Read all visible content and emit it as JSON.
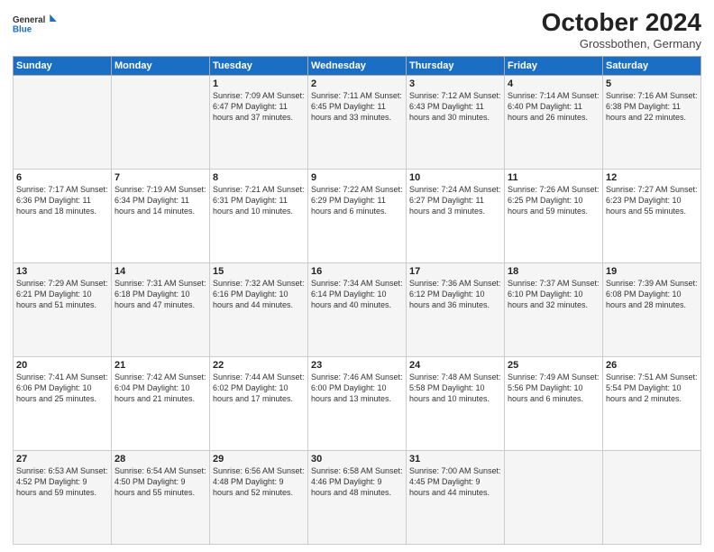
{
  "logo": {
    "general": "General",
    "blue": "Blue"
  },
  "header": {
    "month": "October 2024",
    "location": "Grossbothen, Germany"
  },
  "weekdays": [
    "Sunday",
    "Monday",
    "Tuesday",
    "Wednesday",
    "Thursday",
    "Friday",
    "Saturday"
  ],
  "weeks": [
    [
      {
        "day": "",
        "detail": ""
      },
      {
        "day": "",
        "detail": ""
      },
      {
        "day": "1",
        "detail": "Sunrise: 7:09 AM\nSunset: 6:47 PM\nDaylight: 11 hours and 37 minutes."
      },
      {
        "day": "2",
        "detail": "Sunrise: 7:11 AM\nSunset: 6:45 PM\nDaylight: 11 hours and 33 minutes."
      },
      {
        "day": "3",
        "detail": "Sunrise: 7:12 AM\nSunset: 6:43 PM\nDaylight: 11 hours and 30 minutes."
      },
      {
        "day": "4",
        "detail": "Sunrise: 7:14 AM\nSunset: 6:40 PM\nDaylight: 11 hours and 26 minutes."
      },
      {
        "day": "5",
        "detail": "Sunrise: 7:16 AM\nSunset: 6:38 PM\nDaylight: 11 hours and 22 minutes."
      }
    ],
    [
      {
        "day": "6",
        "detail": "Sunrise: 7:17 AM\nSunset: 6:36 PM\nDaylight: 11 hours and 18 minutes."
      },
      {
        "day": "7",
        "detail": "Sunrise: 7:19 AM\nSunset: 6:34 PM\nDaylight: 11 hours and 14 minutes."
      },
      {
        "day": "8",
        "detail": "Sunrise: 7:21 AM\nSunset: 6:31 PM\nDaylight: 11 hours and 10 minutes."
      },
      {
        "day": "9",
        "detail": "Sunrise: 7:22 AM\nSunset: 6:29 PM\nDaylight: 11 hours and 6 minutes."
      },
      {
        "day": "10",
        "detail": "Sunrise: 7:24 AM\nSunset: 6:27 PM\nDaylight: 11 hours and 3 minutes."
      },
      {
        "day": "11",
        "detail": "Sunrise: 7:26 AM\nSunset: 6:25 PM\nDaylight: 10 hours and 59 minutes."
      },
      {
        "day": "12",
        "detail": "Sunrise: 7:27 AM\nSunset: 6:23 PM\nDaylight: 10 hours and 55 minutes."
      }
    ],
    [
      {
        "day": "13",
        "detail": "Sunrise: 7:29 AM\nSunset: 6:21 PM\nDaylight: 10 hours and 51 minutes."
      },
      {
        "day": "14",
        "detail": "Sunrise: 7:31 AM\nSunset: 6:18 PM\nDaylight: 10 hours and 47 minutes."
      },
      {
        "day": "15",
        "detail": "Sunrise: 7:32 AM\nSunset: 6:16 PM\nDaylight: 10 hours and 44 minutes."
      },
      {
        "day": "16",
        "detail": "Sunrise: 7:34 AM\nSunset: 6:14 PM\nDaylight: 10 hours and 40 minutes."
      },
      {
        "day": "17",
        "detail": "Sunrise: 7:36 AM\nSunset: 6:12 PM\nDaylight: 10 hours and 36 minutes."
      },
      {
        "day": "18",
        "detail": "Sunrise: 7:37 AM\nSunset: 6:10 PM\nDaylight: 10 hours and 32 minutes."
      },
      {
        "day": "19",
        "detail": "Sunrise: 7:39 AM\nSunset: 6:08 PM\nDaylight: 10 hours and 28 minutes."
      }
    ],
    [
      {
        "day": "20",
        "detail": "Sunrise: 7:41 AM\nSunset: 6:06 PM\nDaylight: 10 hours and 25 minutes."
      },
      {
        "day": "21",
        "detail": "Sunrise: 7:42 AM\nSunset: 6:04 PM\nDaylight: 10 hours and 21 minutes."
      },
      {
        "day": "22",
        "detail": "Sunrise: 7:44 AM\nSunset: 6:02 PM\nDaylight: 10 hours and 17 minutes."
      },
      {
        "day": "23",
        "detail": "Sunrise: 7:46 AM\nSunset: 6:00 PM\nDaylight: 10 hours and 13 minutes."
      },
      {
        "day": "24",
        "detail": "Sunrise: 7:48 AM\nSunset: 5:58 PM\nDaylight: 10 hours and 10 minutes."
      },
      {
        "day": "25",
        "detail": "Sunrise: 7:49 AM\nSunset: 5:56 PM\nDaylight: 10 hours and 6 minutes."
      },
      {
        "day": "26",
        "detail": "Sunrise: 7:51 AM\nSunset: 5:54 PM\nDaylight: 10 hours and 2 minutes."
      }
    ],
    [
      {
        "day": "27",
        "detail": "Sunrise: 6:53 AM\nSunset: 4:52 PM\nDaylight: 9 hours and 59 minutes."
      },
      {
        "day": "28",
        "detail": "Sunrise: 6:54 AM\nSunset: 4:50 PM\nDaylight: 9 hours and 55 minutes."
      },
      {
        "day": "29",
        "detail": "Sunrise: 6:56 AM\nSunset: 4:48 PM\nDaylight: 9 hours and 52 minutes."
      },
      {
        "day": "30",
        "detail": "Sunrise: 6:58 AM\nSunset: 4:46 PM\nDaylight: 9 hours and 48 minutes."
      },
      {
        "day": "31",
        "detail": "Sunrise: 7:00 AM\nSunset: 4:45 PM\nDaylight: 9 hours and 44 minutes."
      },
      {
        "day": "",
        "detail": ""
      },
      {
        "day": "",
        "detail": ""
      }
    ]
  ]
}
